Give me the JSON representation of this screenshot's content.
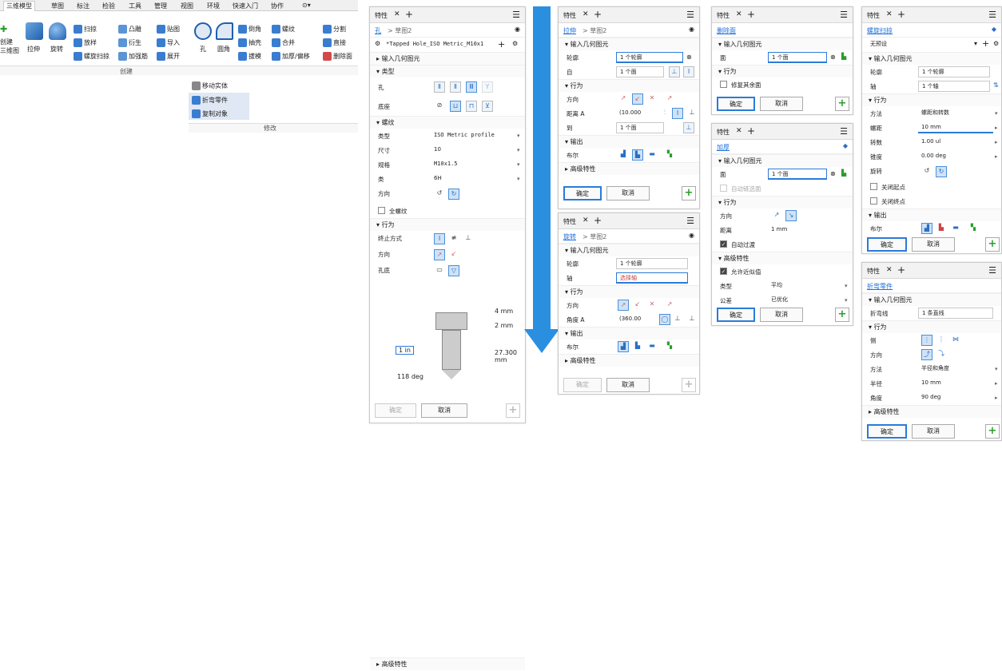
{
  "ribbon": {
    "tabs": [
      "三维模型",
      "草图",
      "标注",
      "检验",
      "工具",
      "管理",
      "视图",
      "环境",
      "快速入门",
      "协作"
    ],
    "left_labels": [
      "创建",
      "三维图"
    ],
    "big": [
      "拉伸",
      "旋转",
      "孔",
      "圆角"
    ],
    "col1": [
      "扫掠",
      "放样",
      "螺旋扫掠"
    ],
    "col2": [
      "凸雕",
      "衍生",
      "加强筋"
    ],
    "col3": [
      "贴图",
      "导入",
      "展开"
    ],
    "col4": [
      "倒角",
      "抽壳",
      "拔模"
    ],
    "col5": [
      "螺纹",
      "合并",
      "加厚/偏移"
    ],
    "col6": [
      "分割",
      "直接",
      "删除面"
    ],
    "group_create": "创建",
    "modify_items": [
      "移动实体",
      "折弯零件",
      "复制对象"
    ],
    "group_modify": "修改"
  },
  "hole": {
    "tab": "特性",
    "crumb_link": "孔",
    "crumb_rest": "> 草图2",
    "preset": "*Tapped Hole_ISO Metric_M10x1",
    "sec_input": "输入几何图元",
    "sec_type": "类型",
    "lab_hole": "孔",
    "lab_seat": "底座",
    "sec_thread": "螺纹",
    "lab_kind": "类型",
    "val_kind": "ISO Metric profile",
    "lab_size": "尺寸",
    "val_size": "10",
    "lab_spec": "规格",
    "val_spec": "M10x1.5",
    "lab_class": "类",
    "val_class": "6H",
    "lab_dir": "方向",
    "full_thread": "全螺纹",
    "sec_behavior": "行为",
    "lab_term": "终止方式",
    "lab_dir2": "方向",
    "lab_bottom": "孔底",
    "dim1": "4 mm",
    "dim2": "2 mm",
    "dim3": "1 in",
    "dim4": "27.300 mm",
    "dim5": "118 deg",
    "sec_adv": "高级特性",
    "ok": "确定",
    "cancel": "取消"
  },
  "extrude": {
    "tab": "特性",
    "crumb_link": "拉伸",
    "crumb_rest": "> 草图2",
    "sec_input": "输入几何图元",
    "lab_profile": "轮廓",
    "val_profile": "1 个轮廓",
    "lab_face": "自",
    "val_face": "1 个面",
    "sec_behavior": "行为",
    "lab_dir": "方向",
    "lab_dist": "距离 A",
    "val_dist": "(10.000",
    "lab_to": "到",
    "val_to": "1 个面",
    "sec_output": "输出",
    "lab_bool": "布尔",
    "sec_adv": "高级特性",
    "ok": "确定",
    "cancel": "取消"
  },
  "revolve": {
    "tab": "特性",
    "crumb_link": "旋转",
    "crumb_rest": "> 草图2",
    "sec_input": "输入几何图元",
    "lab_profile": "轮廓",
    "val_profile": "1 个轮廓",
    "lab_axis": "轴",
    "val_axis": "选择轴",
    "sec_behavior": "行为",
    "lab_dir": "方向",
    "lab_angle": "角度 A",
    "val_angle": "(360.00",
    "sec_output": "输出",
    "lab_bool": "布尔",
    "sec_adv": "高级特性",
    "ok": "确定",
    "cancel": "取消"
  },
  "delface": {
    "tab": "特性",
    "crumb_link": "删除面",
    "sec_input": "输入几何图元",
    "lab_face": "面",
    "val_face": "1 个面",
    "sec_behavior": "行为",
    "repair": "修复其余面",
    "ok": "确定",
    "cancel": "取消"
  },
  "thicken": {
    "tab": "特性",
    "crumb_link": "加厚",
    "sec_input": "输入几何图元",
    "lab_face": "面",
    "val_face": "1 个面",
    "auto_chain": "自动链选面",
    "sec_behavior": "行为",
    "lab_dir": "方向",
    "lab_dist": "距离",
    "val_dist": "1 mm",
    "auto_blend": "自动过渡",
    "sec_adv": "高级特性",
    "approx": "允许近似值",
    "lab_type": "类型",
    "val_type": "平均",
    "lab_tol": "公差",
    "val_tol": "已优化",
    "ok": "确定",
    "cancel": "取消"
  },
  "sweep": {
    "tab": "特性",
    "crumb_link": "螺旋扫掠",
    "preset": "无预设",
    "sec_input": "输入几何图元",
    "lab_profile": "轮廓",
    "val_profile": "1 个轮廓",
    "lab_axis": "轴",
    "val_axis": "1 个轴",
    "sec_behavior": "行为",
    "lab_method": "方法",
    "val_method": "螺距和转数",
    "lab_pitch": "螺距",
    "val_pitch": "10 mm",
    "lab_rev": "转数",
    "val_rev": "1.00 ul",
    "lab_taper": "锥度",
    "val_taper": "0.00 deg",
    "lab_rot": "旋转",
    "close_start": "关闭起点",
    "close_end": "关闭终点",
    "sec_output": "输出",
    "lab_bool": "布尔",
    "ok": "确定",
    "cancel": "取消"
  },
  "bend": {
    "tab": "特性",
    "crumb_link": "折弯零件",
    "sec_input": "输入几何图元",
    "lab_line": "折弯线",
    "val_line": "1 条直线",
    "sec_behavior": "行为",
    "lab_side": "侧",
    "lab_dir": "方向",
    "lab_method": "方法",
    "val_method": "半径和角度",
    "lab_radius": "半径",
    "val_radius": "10 mm",
    "lab_angle": "角度",
    "val_angle": "90 deg",
    "sec_adv": "高级特性",
    "ok": "确定",
    "cancel": "取消"
  },
  "colors": {
    "accent": "#2b7bd9",
    "arrow": "#2b8fe0",
    "green": "#2a9d2a"
  }
}
